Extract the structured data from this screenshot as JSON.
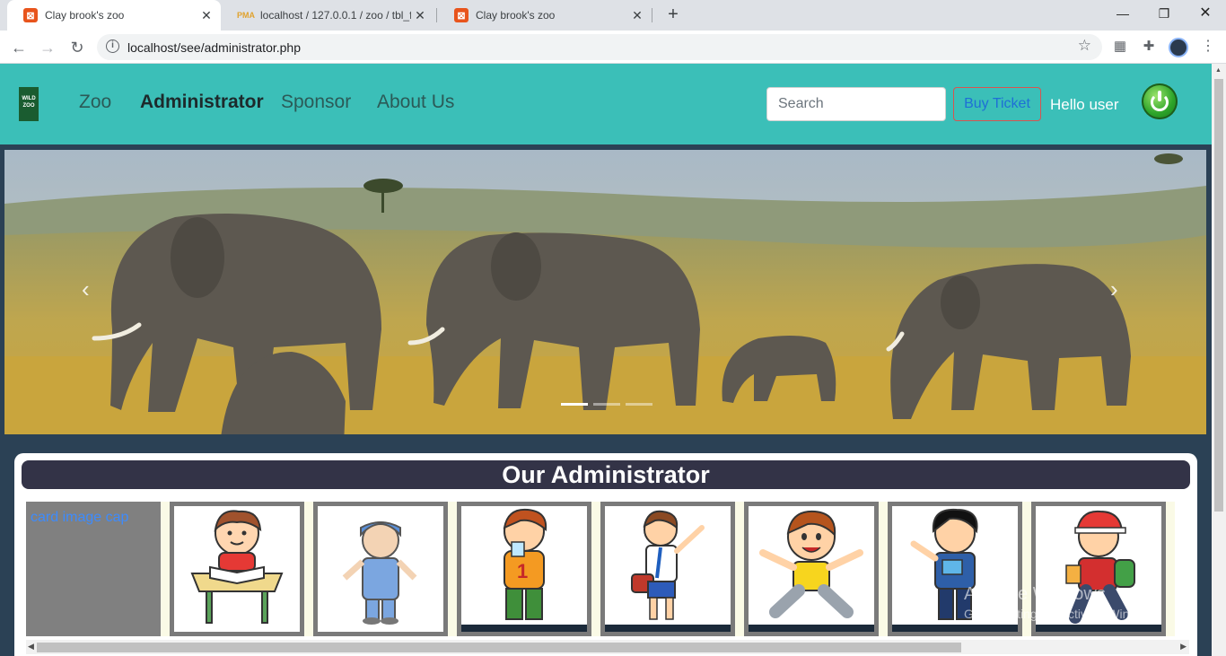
{
  "browser": {
    "tabs": [
      {
        "title": "Clay brook's zoo",
        "favicon": "xampp-icon"
      },
      {
        "title": "localhost / 127.0.0.1 / zoo / tbl_fi",
        "favicon": "phpmyadmin-icon"
      },
      {
        "title": "Clay brook's zoo",
        "favicon": "xampp-icon"
      }
    ],
    "url": "localhost/see/administrator.php"
  },
  "site": {
    "logo_text": "WILDLIFE ZOO",
    "nav": [
      "Zoo",
      "Administrator",
      "Sponsor",
      "About Us"
    ],
    "active_nav": "Administrator",
    "search_placeholder": "Search",
    "buy_ticket": "Buy Ticket",
    "greeting": "Hello user",
    "accent_color": "#3bbfb8",
    "carousel": {
      "slide_description": "Elephants walking across savanna grassland",
      "slides": 3,
      "active_slide": 1
    }
  },
  "admin_section": {
    "title": "Our Administrator",
    "cards": [
      {
        "alt": "card image cap",
        "image": "broken"
      },
      {
        "image": "boy-reading-at-desk"
      },
      {
        "image": "boy-in-overalls"
      },
      {
        "image": "boy-drinking-water"
      },
      {
        "image": "schoolboy-waving"
      },
      {
        "image": "boy-jumping"
      },
      {
        "image": "boy-with-book"
      },
      {
        "image": "boy-with-cap-and-backpack"
      }
    ]
  },
  "watermark": {
    "line1": "Activate Windows",
    "line2": "Go to Settings to activate Windows."
  }
}
